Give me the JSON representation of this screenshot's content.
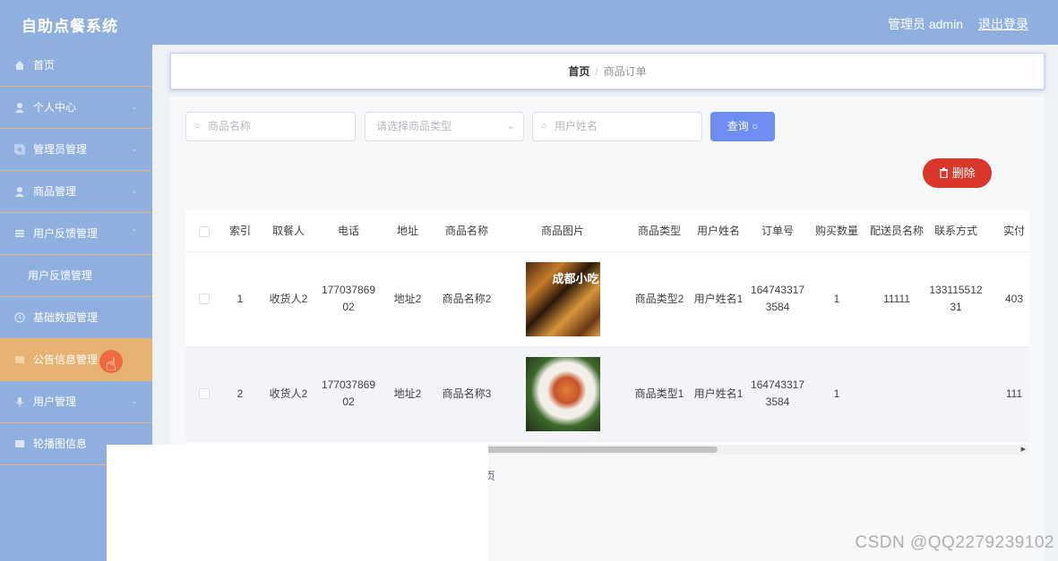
{
  "app": {
    "title": "自助点餐系统",
    "admin_label": "管理员 admin",
    "logout_label": "退出登录"
  },
  "sidebar": {
    "items": [
      {
        "label": "首页",
        "icon": "home-icon"
      },
      {
        "label": "个人中心",
        "icon": "user-icon"
      },
      {
        "label": "管理员管理",
        "icon": "copy-icon"
      },
      {
        "label": "商品管理",
        "icon": "user-icon"
      },
      {
        "label": "用户反馈管理",
        "icon": "list-icon"
      },
      {
        "label": "用户反馈管理",
        "icon": ""
      },
      {
        "label": "基础数据管理",
        "icon": "clock-icon"
      },
      {
        "label": "公告信息管理",
        "icon": "folder-icon"
      },
      {
        "label": "用户管理",
        "icon": "mic-icon"
      },
      {
        "label": "轮播图信息",
        "icon": "folder-icon"
      }
    ]
  },
  "breadcrumb": {
    "home": "首页",
    "separator": "/",
    "current": "商品订单"
  },
  "search": {
    "product_name_placeholder": "商品名称",
    "product_type_placeholder": "请选择商品类型",
    "user_name_placeholder": "用户姓名",
    "query_label": "查询",
    "delete_label": "删除"
  },
  "table": {
    "columns": [
      "索引",
      "取餐人",
      "电话",
      "地址",
      "商品名称",
      "商品图片",
      "商品类型",
      "用户姓名",
      "订单号",
      "购买数量",
      "配送员名称",
      "联系方式",
      "实付"
    ],
    "rows": [
      {
        "index": "1",
        "receiver": "收货人2",
        "phone": "17703786902",
        "address": "地址2",
        "product_name": "商品名称2",
        "image_alt": "food-photo-icon",
        "image_text": "成都小吃",
        "product_type": "商品类型2",
        "user_name": "用户姓名1",
        "order_no": "1647433173584",
        "quantity": "1",
        "courier": "11111",
        "contact": "13311551231",
        "paid": "403"
      },
      {
        "index": "2",
        "receiver": "收货人2",
        "phone": "17703786902",
        "address": "地址2",
        "product_name": "商品名称3",
        "image_alt": "pasta-photo-icon",
        "image_text": "",
        "product_type": "商品类型1",
        "user_name": "用户姓名1",
        "order_no": "1647433173584",
        "quantity": "1",
        "courier": "",
        "contact": "",
        "paid": "111"
      }
    ]
  },
  "footer_fragment": "页",
  "watermark": "CSDN @QQ2279239102",
  "colors": {
    "topbar": "#8fb0df",
    "active_item": "#e6b373",
    "query_button": "#6d8ef0",
    "delete_button": "#d8372a"
  }
}
